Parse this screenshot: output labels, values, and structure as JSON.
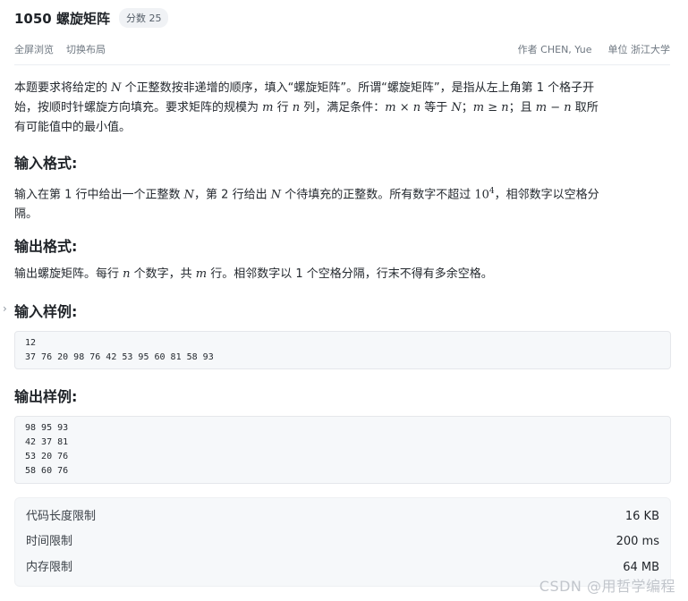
{
  "problem": {
    "title": "1050 螺旋矩阵",
    "score_badge": "分数 25"
  },
  "meta": {
    "fullscreen": "全屏浏览",
    "switch_layout": "切换布局",
    "author": "作者 CHEN, Yue",
    "unit": "单位 浙江大学"
  },
  "description": {
    "p1_a": "本题要求将给定的 ",
    "var_N": "N",
    "p1_b": " 个正整数按非递增的顺序，填入“螺旋矩阵”。所谓“螺旋矩阵”，是指从左上角第 1 个格子开",
    "p1_c": "始，按顺时针螺旋方向填充。要求矩阵的规模为 ",
    "var_m": "m",
    "p1_d": " 行 ",
    "var_n": "n",
    "p1_e": " 列，满足条件：",
    "expr_mxn": "m × n",
    "p1_f": " 等于 ",
    "p1_g": "；",
    "expr_mgen": "m ≥ n",
    "p1_h": "；且 ",
    "expr_mminusn": "m − n",
    "p1_i": " 取所",
    "p1_j": "有可能值中的最小值。"
  },
  "input_format": {
    "heading": "输入格式:",
    "t1": "输入在第 1 行中给出一个正整数 ",
    "t2": "，第 2 行给出 ",
    "t3": " 个待填充的正整数。所有数字不超过 ",
    "base": "10",
    "exp": "4",
    "t4": "，相邻数字以空格分",
    "t5": "隔。"
  },
  "output_format": {
    "heading": "输出格式:",
    "t1": "输出螺旋矩阵。每行 ",
    "t2": " 个数字，共 ",
    "t3": " 行。相邻数字以 1 个空格分隔，行末不得有多余空格。"
  },
  "sample_input": {
    "heading": "输入样例:",
    "code": "12\n37 76 20 98 76 42 53 95 60 81 58 93"
  },
  "sample_output": {
    "heading": "输出样例:",
    "code": "98 95 93\n42 37 81\n53 20 76\n58 60 76"
  },
  "limits": [
    {
      "label": "代码长度限制",
      "value": "16 KB"
    },
    {
      "label": "时间限制",
      "value": "200 ms"
    },
    {
      "label": "内存限制",
      "value": "64 MB"
    }
  ],
  "watermark": "CSDN @用哲学编程",
  "icons": {
    "expand": "chevron-right-icon"
  }
}
